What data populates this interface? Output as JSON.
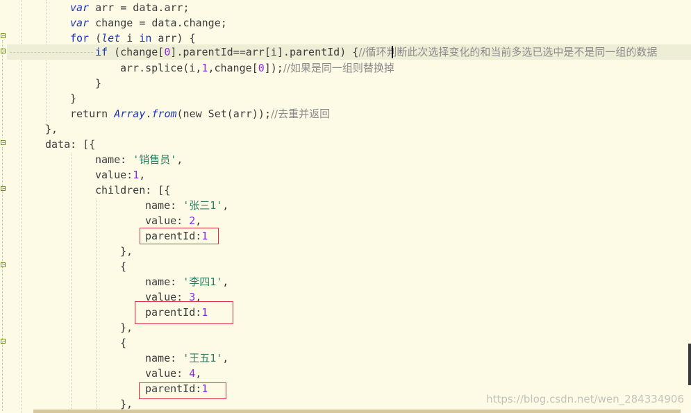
{
  "code": {
    "l1": {
      "a": "var",
      "b": " arr = data.arr;"
    },
    "l2": {
      "a": "var",
      "b": " change = data.change;"
    },
    "l3": {
      "a": "for",
      "b": " (",
      "c": "let",
      "d": " i ",
      "e": "in",
      "f": " arr) {"
    },
    "l4": {
      "a": "if",
      "b": " (change[",
      "n": "0",
      "c": "].parentId==arr[i].parentId) {",
      "cm": "//循环判断此次选择变化的和当前多选已选中是不是同一组的数据"
    },
    "l5": {
      "a": "arr.splice(i,",
      "n1": "1",
      "b": ",change[",
      "n2": "0",
      "c": "]);",
      "cm": "//如果是同一组则替换掉"
    },
    "l6": {
      "a": "}"
    },
    "l7": {
      "a": "}"
    },
    "l8": {
      "a": "return ",
      "b": "Array",
      ".": ".",
      "c": "from",
      "d": "(new Set(arr));",
      "cm": "//去重并返回"
    },
    "l9": {
      "a": "},"
    },
    "l10": {
      "a": "data: [{"
    },
    "l11": {
      "a": "name: ",
      "s": "'销售员'",
      "b": ","
    },
    "l12": {
      "a": "value:",
      "n": "1",
      "b": ","
    },
    "l13": {
      "a": "children: [{"
    },
    "l14": {
      "a": "name: ",
      "s": "'张三1'",
      "b": ","
    },
    "l15": {
      "a": "value: ",
      "n": "2",
      "b": ","
    },
    "l16": {
      "a": "parentId:",
      "n": "1"
    },
    "l17": {
      "a": "},"
    },
    "l18": {
      "a": "{"
    },
    "l19": {
      "a": "name: ",
      "s": "'李四1'",
      "b": ","
    },
    "l20": {
      "a": "value: ",
      "n": "3",
      "b": ","
    },
    "l21": {
      "a": "parentId:",
      "n": "1"
    },
    "l22": {
      "a": "},"
    },
    "l23": {
      "a": "{"
    },
    "l24": {
      "a": "name: ",
      "s": "'王五1'",
      "b": ","
    },
    "l25": {
      "a": "value: ",
      "n": "4",
      "b": ","
    },
    "l26": {
      "a": "parentId:",
      "n": "1"
    },
    "l27": {
      "a": "},"
    }
  },
  "watermark": "https://blog.csdn.net/wen_284334906",
  "colors": {
    "background": "#fdfbe6",
    "keyword": "#1d35b8",
    "string": "#2e7d63",
    "number": "#8a2be2",
    "comment": "#8a8a8a",
    "highlight_box": "#e0323c"
  }
}
